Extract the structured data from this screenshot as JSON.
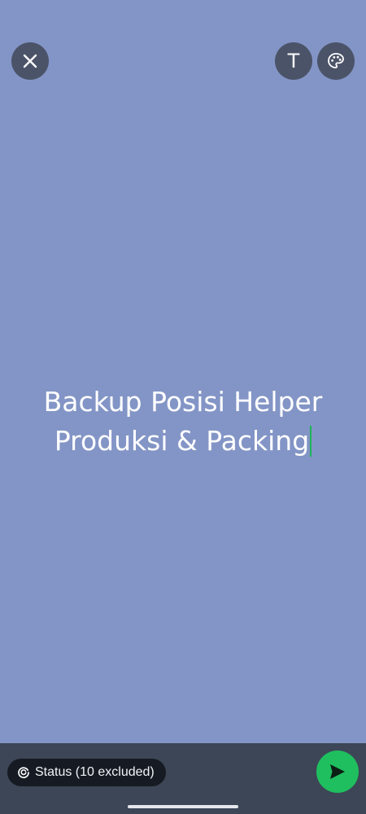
{
  "colors": {
    "background": "#8395c6",
    "button_bg": "#4b5368",
    "bottom_bar": "#3d4656",
    "chip_bg": "#161b23",
    "accent_green": "#1fbf5f",
    "caret": "#1fb457"
  },
  "toolbar": {
    "close_icon": "close-icon",
    "text_button_label": "T",
    "palette_icon": "palette-icon"
  },
  "status_text": {
    "line1": "Backup Posisi Helper",
    "line2": "Produksi & Packing"
  },
  "bottom": {
    "audience_icon": "status-ring-icon",
    "audience_label": "Status (10 excluded)",
    "send_icon": "send-icon"
  }
}
